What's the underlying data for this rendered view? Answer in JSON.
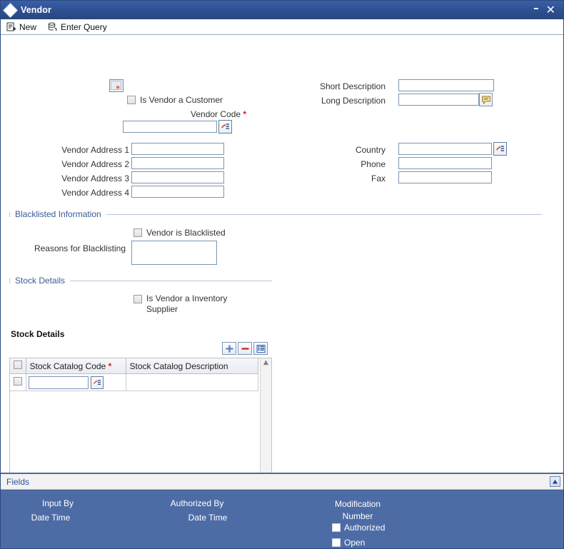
{
  "window": {
    "title": "Vendor",
    "icon": "diamond-icon",
    "minimize_label": "–",
    "close_label": "✕"
  },
  "toolbar": {
    "items": [
      {
        "label": "New",
        "icon": "new-document-icon"
      },
      {
        "label": "Enter Query",
        "icon": "database-query-icon"
      }
    ]
  },
  "form": {
    "image_placeholder": "broken-image-icon",
    "is_vendor_customer": {
      "label": "Is Vendor a Customer",
      "checked": false
    },
    "vendor_code": {
      "label": "Vendor Code",
      "required": "*",
      "value": "",
      "lov_icon": "lov-icon"
    },
    "short_description": {
      "label": "Short Description",
      "value": ""
    },
    "long_description": {
      "label": "Long Description",
      "value": "",
      "button_icon": "comment-bubble-icon"
    },
    "addresses": [
      {
        "label": "Vendor Address 1",
        "value": ""
      },
      {
        "label": "Vendor Address 2",
        "value": ""
      },
      {
        "label": "Vendor Address 3",
        "value": ""
      },
      {
        "label": "Vendor Address 4",
        "value": ""
      }
    ],
    "country": {
      "label": "Country",
      "value": "",
      "lov_icon": "lov-icon"
    },
    "phone": {
      "label": "Phone",
      "value": ""
    },
    "fax": {
      "label": "Fax",
      "value": ""
    }
  },
  "blacklisted_section": {
    "title": "Blacklisted Information",
    "vendor_is_blacklisted": {
      "label": "Vendor is Blacklisted",
      "checked": false
    },
    "reasons": {
      "label": "Reasons for Blacklisting",
      "value": ""
    }
  },
  "stock_section": {
    "title": "Stock Details",
    "is_inventory_supplier": {
      "label": "Is Vendor a Inventory Supplier",
      "checked": false
    }
  },
  "stock_grid": {
    "title": "Stock Details",
    "buttons": [
      {
        "name": "add-row-button",
        "icon": "plus-icon",
        "label": "+"
      },
      {
        "name": "delete-row-button",
        "icon": "minus-icon",
        "label": "−"
      },
      {
        "name": "grid-view-button",
        "icon": "grid-list-icon",
        "label": "≡"
      }
    ],
    "columns": [
      {
        "label": "Stock Catalog Code",
        "required": "*"
      },
      {
        "label": "Stock Catalog Description",
        "required": ""
      }
    ],
    "rows": [
      {
        "stock_catalog_code": "",
        "stock_catalog_description": "",
        "lov_icon": "lov-icon"
      }
    ],
    "scroll_up": "▲",
    "scroll_down": "▼",
    "scroll_left": "◄",
    "scroll_right": "►"
  },
  "fields_bar": {
    "link_label": "Fields",
    "collapse_icon": "triangle-up-icon"
  },
  "footer": {
    "input_by_label": "Input By",
    "input_date_time_label": "Date Time",
    "authorized_by_label": "Authorized By",
    "authorized_date_time_label": "Date Time",
    "modification_number_label": "Modification Number",
    "authorized_checkbox": {
      "label": "Authorized",
      "checked": false
    },
    "open_checkbox": {
      "label": "Open",
      "checked": false
    }
  },
  "colors": {
    "title_bar": "#2f5295",
    "footer": "#4d6ca6",
    "section_title": "#3a5c93",
    "required_asterisk": "#d42020",
    "link": "#2b4f9e",
    "field_border": "#7c96b2"
  }
}
